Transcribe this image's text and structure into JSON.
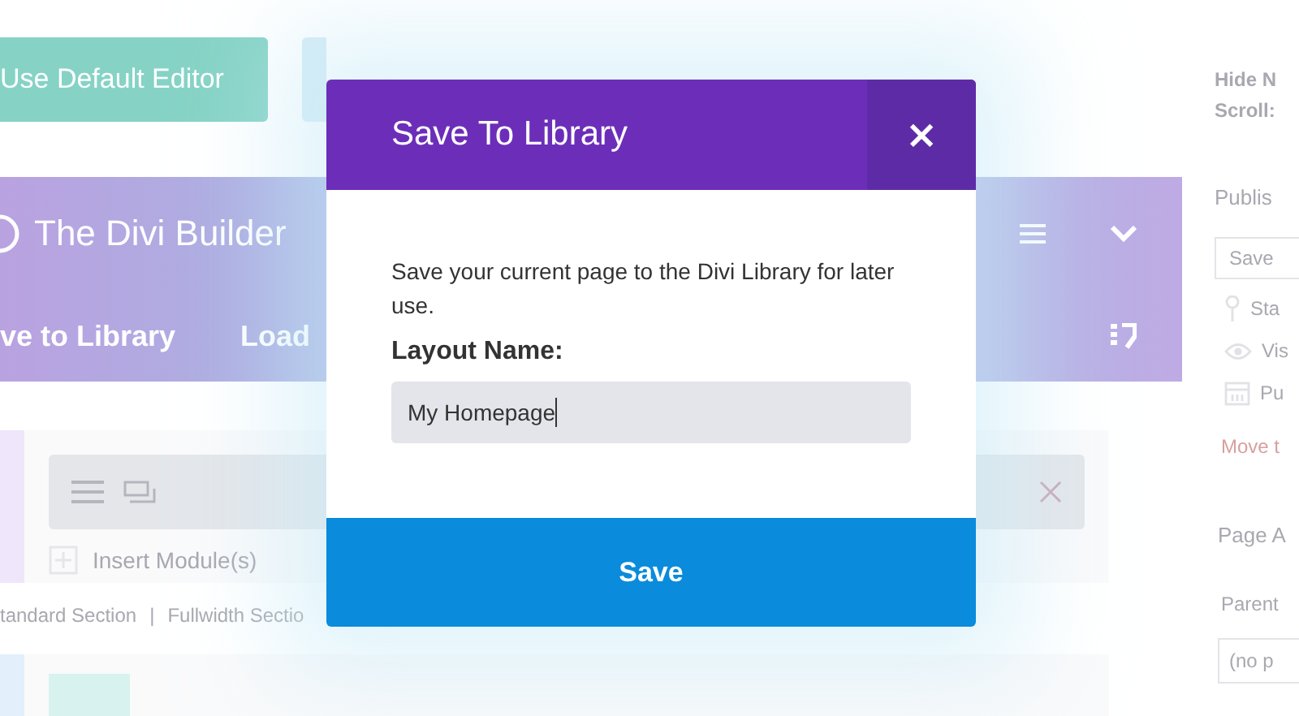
{
  "background": {
    "editor_button": "Use Default Editor",
    "builder": {
      "title": "The Divi Builder",
      "actions": [
        "ve to Library",
        "Load"
      ]
    },
    "section": {
      "insert_label": "Insert Module(s)"
    },
    "section_links": [
      "tandard Section",
      "|",
      "Fullwidth Sectio"
    ],
    "sidebar": {
      "box_title": [
        "Hide N",
        "Scroll:"
      ],
      "publish_title": "Publis",
      "save_button": "Save",
      "meta": [
        {
          "kind": "pin",
          "text": "Sta"
        },
        {
          "kind": "eye",
          "text": "Vis"
        },
        {
          "kind": "calendar",
          "text": "Pu"
        }
      ],
      "trash_link": "Move t",
      "attributes_title": "Page A",
      "parent_label": "Parent",
      "parent_select": "(no p"
    }
  },
  "modal": {
    "title": "Save To Library",
    "close": "×",
    "description": "Save your current page to the Divi Library for later use.",
    "field_label": "Layout Name:",
    "field_value": "My Homepage",
    "save_button": "Save"
  }
}
